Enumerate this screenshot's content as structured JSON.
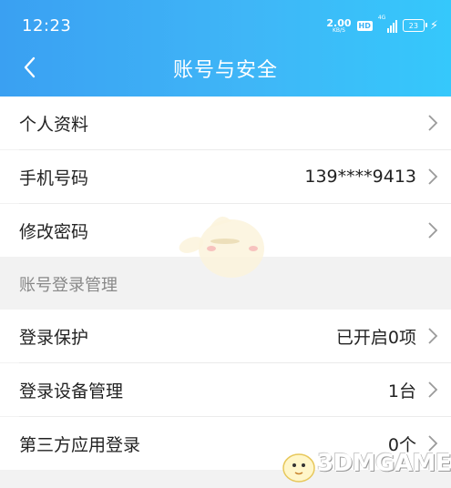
{
  "status_bar": {
    "time": "12:23",
    "speed_value": "2.00",
    "speed_unit": "KB/S",
    "hd": "HD",
    "network": "4G",
    "battery": "23"
  },
  "header": {
    "title": "账号与安全",
    "color_start": "#3aa0f2",
    "color_end": "#35c8fb"
  },
  "rows": {
    "profile": {
      "label": "个人资料",
      "value": ""
    },
    "phone": {
      "label": "手机号码",
      "value": "139****9413"
    },
    "password": {
      "label": "修改密码",
      "value": ""
    }
  },
  "section": {
    "label": "账号登录管理"
  },
  "rows2": {
    "login_protect": {
      "label": "登录保护",
      "value": "已开启0项"
    },
    "devices": {
      "label": "登录设备管理",
      "value": "1台"
    },
    "third_party": {
      "label": "第三方应用登录",
      "value": "0个"
    }
  },
  "watermark": {
    "text": "3DMGAME"
  }
}
